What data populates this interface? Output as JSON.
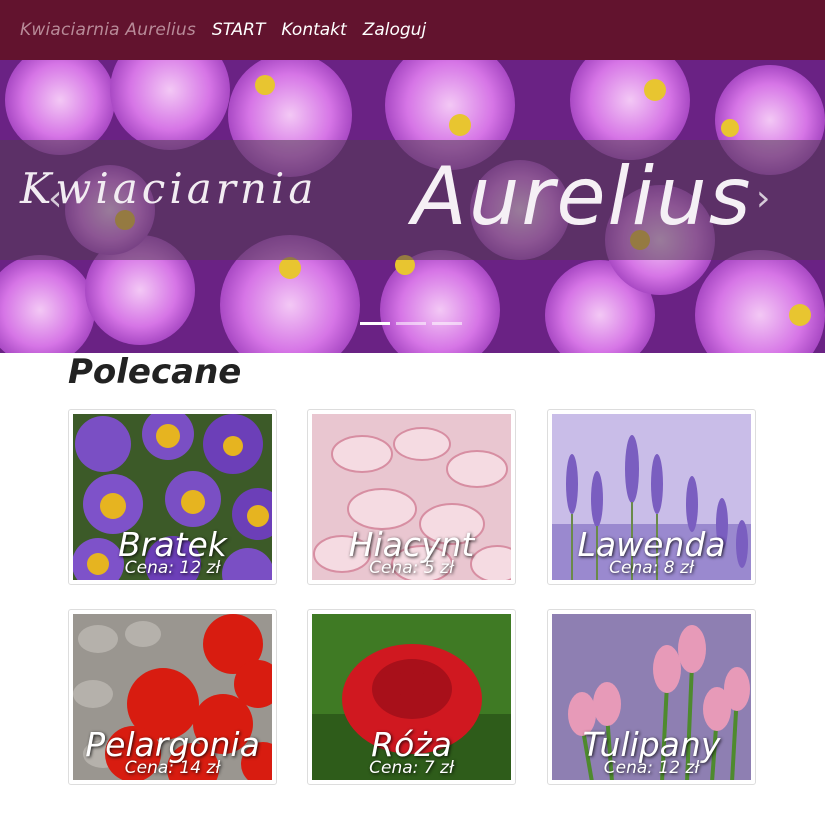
{
  "navbar": {
    "brand": "Kwiaciarnia Aurelius",
    "links": [
      "START",
      "Kontakt",
      "Zaloguj"
    ]
  },
  "carousel": {
    "caption_left": "Kwiaciarnia",
    "caption_right": "Aurelius",
    "prev_icon": "‹",
    "next_icon": "›",
    "indicator_count": 3,
    "active_index": 0
  },
  "featured": {
    "title": "Polecane",
    "products": [
      {
        "name": "Bratek",
        "price": "Cena: 12 zł"
      },
      {
        "name": "Hiacynt",
        "price": "Cena: 5 zł"
      },
      {
        "name": "Lawenda",
        "price": "Cena: 8 zł"
      },
      {
        "name": "Pelargonia",
        "price": "Cena: 14 zł"
      },
      {
        "name": "Róża",
        "price": "Cena: 7 zł"
      },
      {
        "name": "Tulipany",
        "price": "Cena: 12 zł"
      }
    ]
  },
  "colors": {
    "navbar": "#62132e",
    "brand_text": "#b88a98"
  }
}
